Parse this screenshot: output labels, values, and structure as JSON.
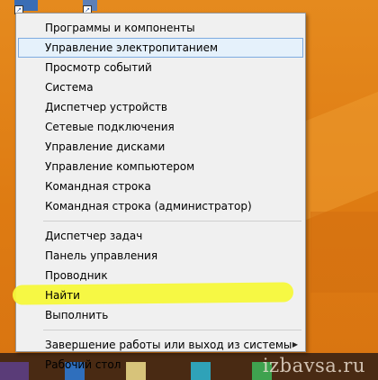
{
  "menu": {
    "groups": [
      [
        {
          "label": "Программы и компоненты"
        },
        {
          "label": "Управление электропитанием",
          "hover": true
        },
        {
          "label": "Просмотр событий"
        },
        {
          "label": "Система"
        },
        {
          "label": "Диспетчер устройств"
        },
        {
          "label": "Сетевые подключения"
        },
        {
          "label": "Управление дисками"
        },
        {
          "label": "Управление компьютером"
        },
        {
          "label": "Командная строка"
        },
        {
          "label": "Командная строка (администратор)"
        }
      ],
      [
        {
          "label": "Диспетчер задач"
        },
        {
          "label": "Панель управления"
        },
        {
          "label": "Проводник"
        },
        {
          "label": "Найти",
          "highlighted": true
        },
        {
          "label": "Выполнить"
        }
      ],
      [
        {
          "label": "Завершение работы или выход из системы",
          "submenu": true
        },
        {
          "label": "Рабочий стол"
        }
      ]
    ]
  },
  "desktop": {
    "watermark": "izbavsa.ru"
  },
  "colors": {
    "desktop": "#e07e14",
    "menu_bg": "#f0f0f0",
    "hover_bg": "#e5f1fb",
    "hover_border": "#7dabe0",
    "highlighter": "#f5f83a"
  },
  "icons": {
    "submenu": "chevron-right-icon",
    "shortcut": "shortcut-arrow-icon"
  }
}
